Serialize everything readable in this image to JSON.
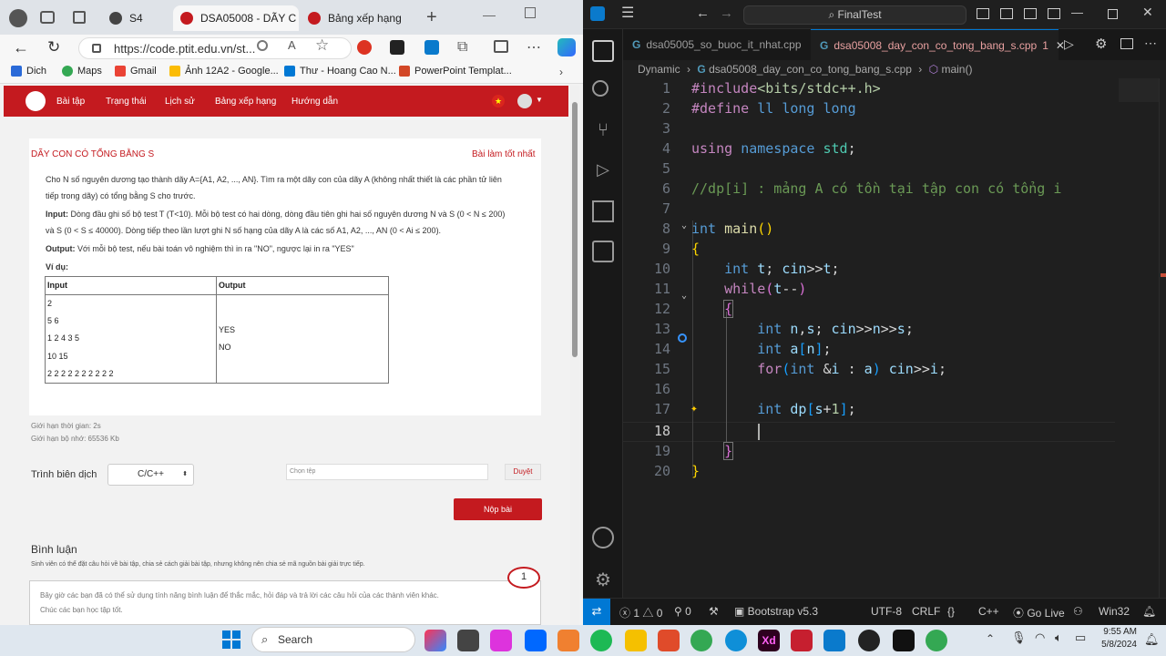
{
  "browser": {
    "tabs": [
      {
        "label": "S4"
      },
      {
        "label": "DSA05008 - DÃY C"
      },
      {
        "label": "Bảng xếp hạng"
      }
    ],
    "url": "https://code.ptit.edu.vn/st...",
    "bookmarks": [
      "Dich",
      "Maps",
      "Gmail",
      "Ảnh 12A2 - Google...",
      "Thư - Hoang Cao N...",
      "PowerPoint Templat..."
    ],
    "nav": [
      "Bài tập",
      "Trạng thái",
      "Lịch sử",
      "Bảng xếp hạng",
      "Hướng dẫn"
    ],
    "problem": {
      "title": "DÃY CON CÓ TỔNG BẰNG S",
      "best_link": "Bài làm tốt nhất",
      "desc_line1": "Cho N  số nguyên dương tạo thành dãy A={A1, A2, ..., AN}. Tìm ra một dãy con của dãy A (không nhất thiết là các phần tử liên",
      "desc_line2": "tiếp trong dãy) có tổng bằng S cho trước.",
      "input_label": "Input:",
      "input_line1": " Dòng đầu ghi số bộ test T (T<10).  Mỗi bộ test có hai dòng, dòng đầu tiên ghi hai số nguyên dương N và S (0 < N ≤ 200)",
      "input_line2": "và S (0 < S ≤ 40000). Dòng tiếp theo lần lượt ghi N số hạng của dãy A là các số A1, A2, ..., AN (0 < Ai ≤ 200).",
      "output_label": "Output:",
      "output_text": "  Với mỗi bộ test, nếu bài toán vô nghiệm thì in ra \"NO\", ngược lại in ra \"YES\"",
      "example_label": "Ví dụ:",
      "table_headers": [
        "Input",
        "Output"
      ],
      "sample_input": [
        "2",
        "5 6",
        "1 2 4 3 5",
        "10 15",
        "2 2 2 2 2 2 2 2 2 2"
      ],
      "sample_output": [
        "YES",
        "NO"
      ],
      "time_limit": "Giới hạn thời gian: 2s",
      "mem_limit": "Giới hạn bộ nhớ: 65536 Kb"
    },
    "compiler_label": "Trình biên dịch",
    "compiler_value": "C/C++",
    "file_placeholder": "Chọn tệp",
    "browse_label": "Duyệt",
    "submit_label": "Nộp bài",
    "comments": {
      "title": "Bình luận",
      "desc": "Sinh viên có thể đặt câu hỏi về bài tập, chia sẻ cách giải bài tập, nhưng không nên chia sẻ mã nguồn bài giải trực tiếp.",
      "badge": "1",
      "box_line1": "Bây giờ các bạn đã có thể sử dụng tính năng bình luận để thắc mắc, hỏi đáp và trả lời các câu hỏi của các thành viên khác.",
      "box_line2": "Chúc các bạn học tập tốt."
    },
    "colors": {
      "brand": "#c41a1f"
    }
  },
  "vscode": {
    "search_text": "FinalTest",
    "tabs": [
      {
        "label": "dsa05005_so_buoc_it_nhat.cpp"
      },
      {
        "label": "dsa05008_day_con_co_tong_bang_s.cpp",
        "badge": "1"
      }
    ],
    "breadcrumb": {
      "folder": "Dynamic",
      "file": "dsa05008_day_con_co_tong_bang_s.cpp",
      "symbol": "main()"
    },
    "line_numbers": [
      "1",
      "2",
      "3",
      "4",
      "5",
      "6",
      "7",
      "8",
      "9",
      "10",
      "11",
      "12",
      "13",
      "14",
      "15",
      "16",
      "17",
      "18",
      "19",
      "20"
    ],
    "status": {
      "errors": "1",
      "warnings": "0",
      "ports": "0",
      "bootstrap": "Bootstrap v5.3",
      "encoding": "UTF-8",
      "eol": "CRLF",
      "language": "C++",
      "golive": "Go Live",
      "platform": "Win32"
    }
  },
  "taskbar": {
    "search_label": "Search",
    "time": "9:55 AM",
    "date": "5/8/2024"
  }
}
